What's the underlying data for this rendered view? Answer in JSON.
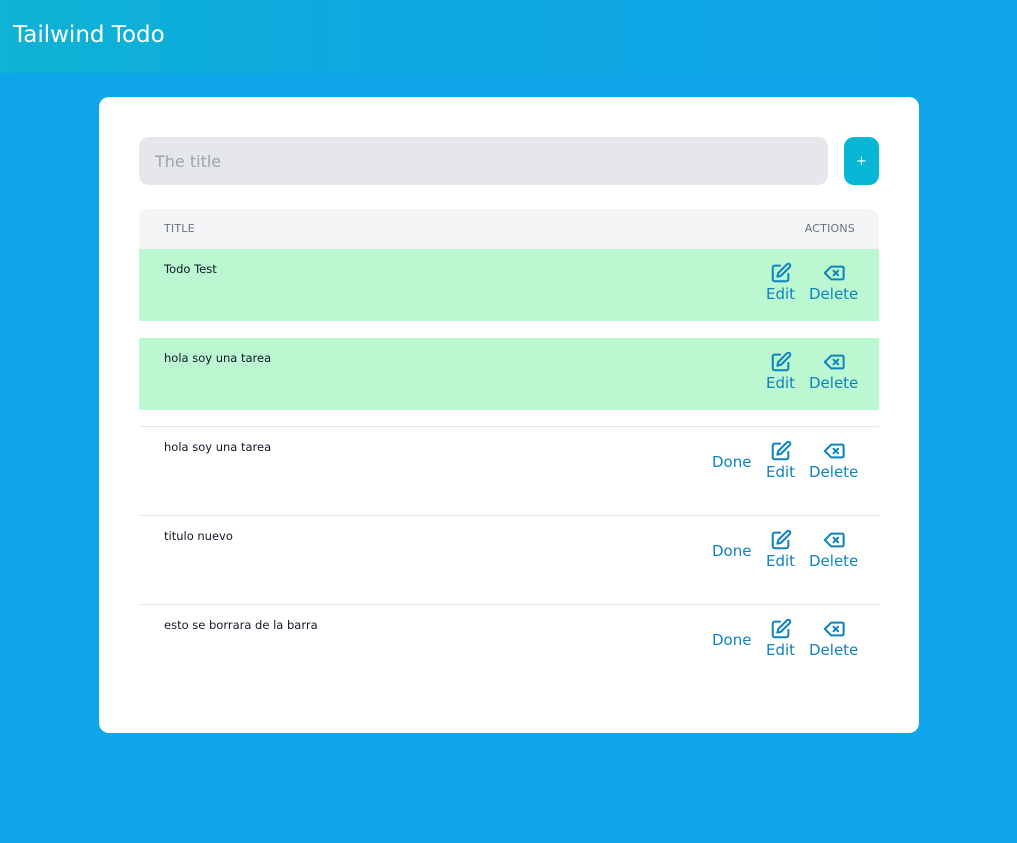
{
  "header": {
    "title": "Tailwind Todo"
  },
  "form": {
    "placeholder": "The title",
    "add_label": "+"
  },
  "table": {
    "col_title": "TITLE",
    "col_actions": "ACTIONS"
  },
  "actions": {
    "done": "Done",
    "edit": "Edit",
    "delete": "Delete"
  },
  "icons": {
    "edit": "edit-pencil-icon",
    "delete": "backspace-delete-icon"
  },
  "colors": {
    "background": "#0ea5e9",
    "done_row": "#bbf7d0",
    "add_button": "#06b6d4",
    "action_text": "#0e83bf"
  },
  "todos": [
    {
      "title": "Todo Test",
      "done": true
    },
    {
      "title": "hola soy una tarea",
      "done": true
    },
    {
      "title": "hola soy una tarea",
      "done": false
    },
    {
      "title": "titulo nuevo",
      "done": false
    },
    {
      "title": "esto se borrara de la barra",
      "done": false
    }
  ]
}
